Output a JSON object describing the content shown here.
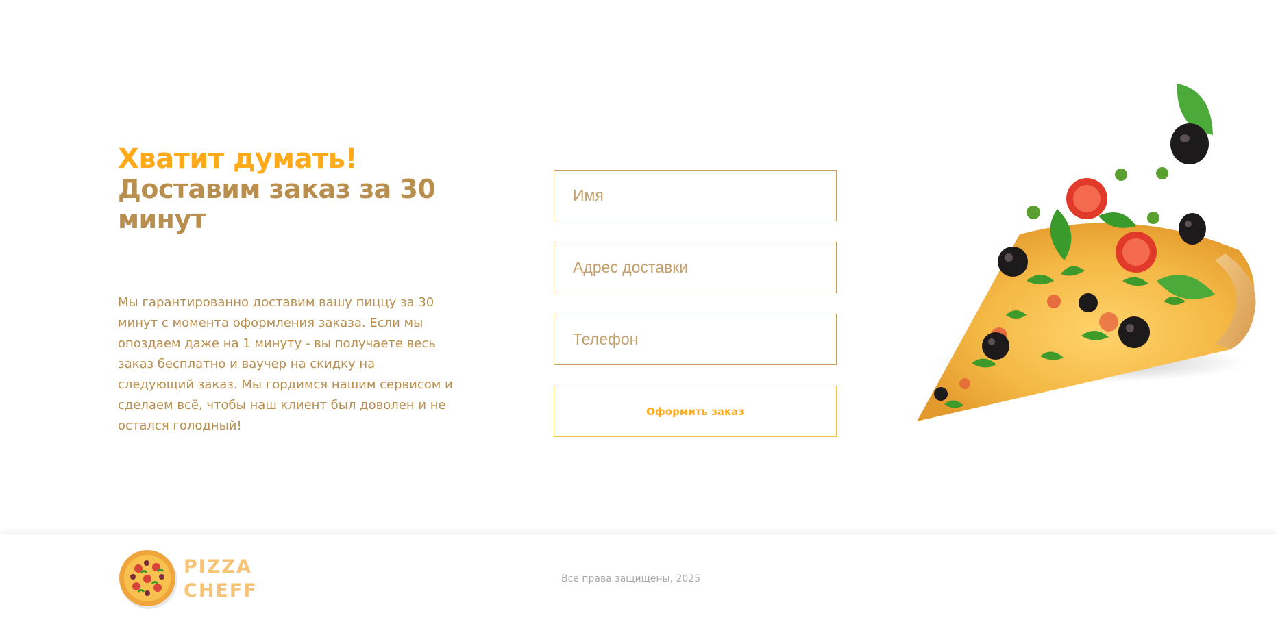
{
  "order": {
    "title_accent": "Хватит думать!",
    "title_main": "Доставим заказ за 30 минут",
    "description": "Мы гарантированно доставим вашу пиццу за 30 минут с момента оформления заказа. Если мы опоздаем даже на 1 минуту - вы получаете весь заказ бесплатно и ваучер на скидку на следующий заказ. Мы гордимся нашим сервисом и сделаем всё, чтобы наш клиент был доволен и не остался голодный!",
    "form": {
      "name_placeholder": "Имя",
      "address_placeholder": "Адрес доставки",
      "phone_placeholder": "Телефон",
      "submit_label": "Оформить заказ"
    },
    "image": "pizza-slice-with-flying-toppings"
  },
  "footer": {
    "logo_line1": "PIZZA",
    "logo_line2": "CHEFF",
    "copyright": "Все права защищены, 2025"
  },
  "colors": {
    "accent": "#ffaa1a",
    "brown": "#b88f4f",
    "logo_text": "#f7c477",
    "muted": "#a9a9a9"
  }
}
